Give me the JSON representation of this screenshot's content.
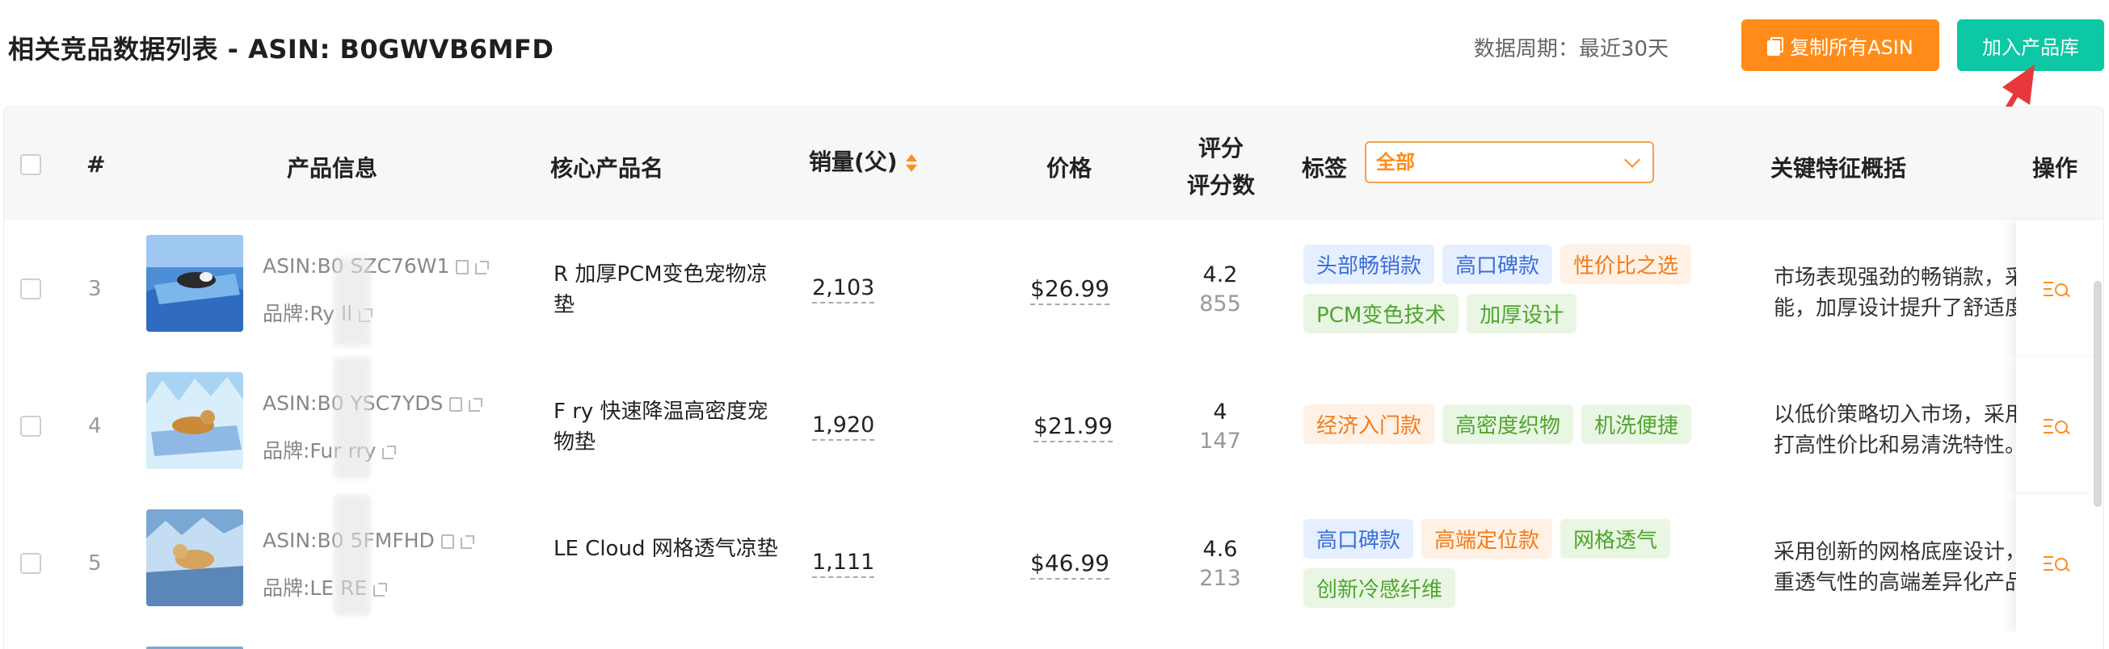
{
  "header": {
    "title": "相关竞品数据列表 - ASIN: B0GWVB6MFD",
    "period": "数据周期：最近30天",
    "copy_button": "复制所有ASIN",
    "add_button": "加入产品库"
  },
  "table": {
    "columns": {
      "num": "#",
      "product_info": "产品信息",
      "core_name": "核心产品名",
      "sales": "销量(父)",
      "price": "价格",
      "rating_line1": "评分",
      "rating_line2": "评分数",
      "tags": "标签",
      "tags_filter": "全部",
      "features": "关键特征概括",
      "ops": "操作"
    },
    "rows": [
      {
        "num": "3",
        "asin": "ASIN:B0  SZC76W1",
        "brand": "品牌:Ry   ll",
        "core_name": "R     加厚PCM变色宠物凉垫",
        "sales": "2,103",
        "price": "$26.99",
        "rating": "4.2",
        "rating_count": "855",
        "tags": [
          {
            "label": "头部畅销款",
            "color": "blue"
          },
          {
            "label": "高口碑款",
            "color": "blue"
          },
          {
            "label": "性价比之选",
            "color": "orange"
          },
          {
            "label": "PCM变色技术",
            "color": "green"
          },
          {
            "label": "加厚设计",
            "color": "green"
          }
        ],
        "feature_line1": "市场表现强劲的畅销款，采",
        "feature_line2": "能，加厚设计提升了舒适度"
      },
      {
        "num": "4",
        "asin": "ASIN:B0  YSC7YDS",
        "brand": "品牌:Fur  rry",
        "core_name": "F     ry 快速降温高密度宠物垫",
        "sales": "1,920",
        "price": "$21.99",
        "rating": "4",
        "rating_count": "147",
        "tags": [
          {
            "label": "经济入门款",
            "color": "orange"
          },
          {
            "label": "高密度织物",
            "color": "green"
          },
          {
            "label": "机洗便捷",
            "color": "green"
          }
        ],
        "feature_line1": "以低价策略切入市场，采用",
        "feature_line2": "打高性价比和易清洗特性。"
      },
      {
        "num": "5",
        "asin": "ASIN:B0  5FMFHD",
        "brand": "品牌:LE   RE",
        "core_name": "LE        Cloud 网格透气凉垫",
        "sales": "1,111",
        "price": "$46.99",
        "rating": "4.6",
        "rating_count": "213",
        "tags": [
          {
            "label": "高口碑款",
            "color": "blue"
          },
          {
            "label": "高端定位款",
            "color": "orange"
          },
          {
            "label": "网格透气",
            "color": "green"
          },
          {
            "label": "创新冷感纤维",
            "color": "green"
          }
        ],
        "feature_line1": "采用创新的网格底座设计，",
        "feature_line2": "重透气性的高端差异化产品"
      }
    ]
  },
  "colors": {
    "orange": "#ff8c1a",
    "teal": "#0cc8a4",
    "arrow_red": "#e8383d"
  }
}
